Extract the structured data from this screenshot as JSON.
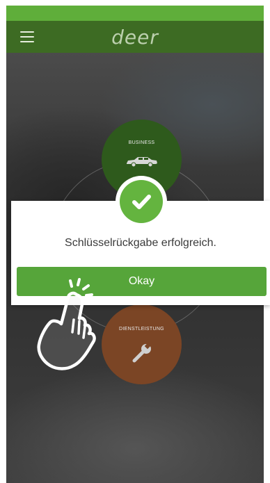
{
  "app_bar": {
    "logo_text": "deer",
    "menu_icon": "hamburger-icon"
  },
  "circles": {
    "business": {
      "label": "BUSINESS",
      "icon": "car-icon",
      "color": "#2e5a1c"
    },
    "service": {
      "label": "DIENSTLEISTUNG",
      "icon": "wrench-icon",
      "color": "#7b4525"
    }
  },
  "dialog": {
    "message": "Schlüsselrückgabe erfolgreich.",
    "button_label": "Okay",
    "status_icon": "check-icon"
  },
  "colors": {
    "status_bar": "#5fae3a",
    "app_bar": "#3d6b23",
    "button": "#56a53a",
    "check": "#64b43f"
  },
  "overlay": {
    "icon": "tap-hand-icon"
  }
}
